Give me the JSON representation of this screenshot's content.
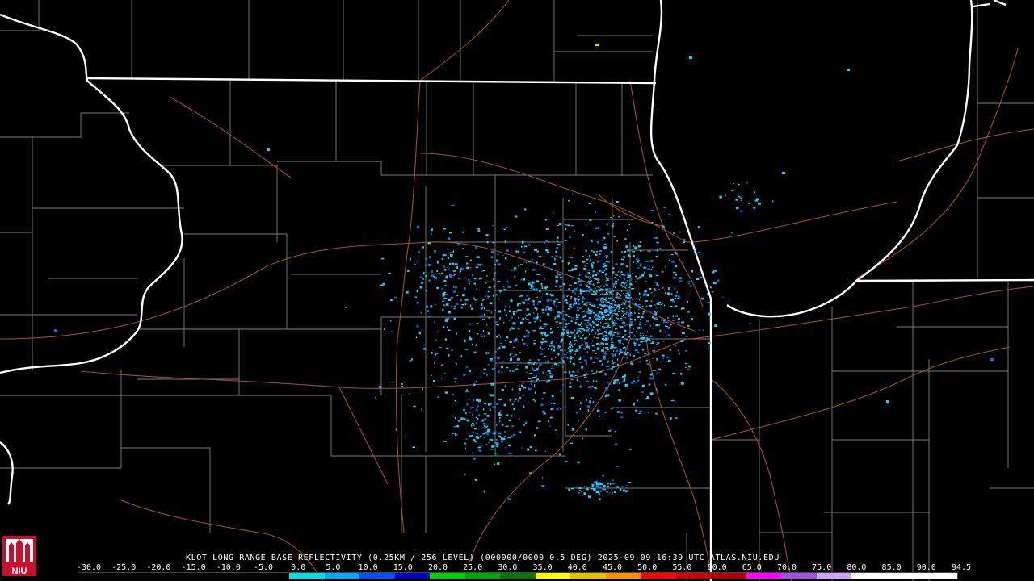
{
  "product_title": "KLOT LONG RANGE BASE REFLECTIVITY (0.25KM / 256 LEVEL) (000000/0000 0.5 DEG) 2025-09-09 16:39 UTC  ATLAS.NIU.EDU",
  "logo_text": "NIU",
  "scale_labels": [
    "-30.0",
    "-25.0",
    "-20.0",
    "-15.0",
    "-10.0",
    "-5.0",
    "0.0",
    "5.0",
    "10.0",
    "15.0",
    "20.0",
    "25.0",
    "30.0",
    "35.0",
    "40.0",
    "45.0",
    "50.0",
    "55.0",
    "60.0",
    "65.0",
    "70.0",
    "75.0",
    "80.0",
    "85.0",
    "90.0",
    "94.5"
  ],
  "scale_colors": [
    "#000000",
    "#000000",
    "#000000",
    "#000000",
    "#000000",
    "#000000",
    "#00e0e0",
    "#00a8ff",
    "#0050ff",
    "#0000c0",
    "#00d000",
    "#00a800",
    "#007800",
    "#ffff00",
    "#e8c000",
    "#ff9000",
    "#ff0000",
    "#d00000",
    "#b00000",
    "#ff00ff",
    "#a050e0",
    "#d0a0ff",
    "#ffffff",
    "#ffffff",
    "#ffffff"
  ],
  "colors": {
    "background": "#000000",
    "state_border": "#ffffff",
    "county_border": "#8a8a8a",
    "highway": "#a0522d",
    "echo_light": "#2ec8f0",
    "echo_dark": "#1a6ee6"
  }
}
